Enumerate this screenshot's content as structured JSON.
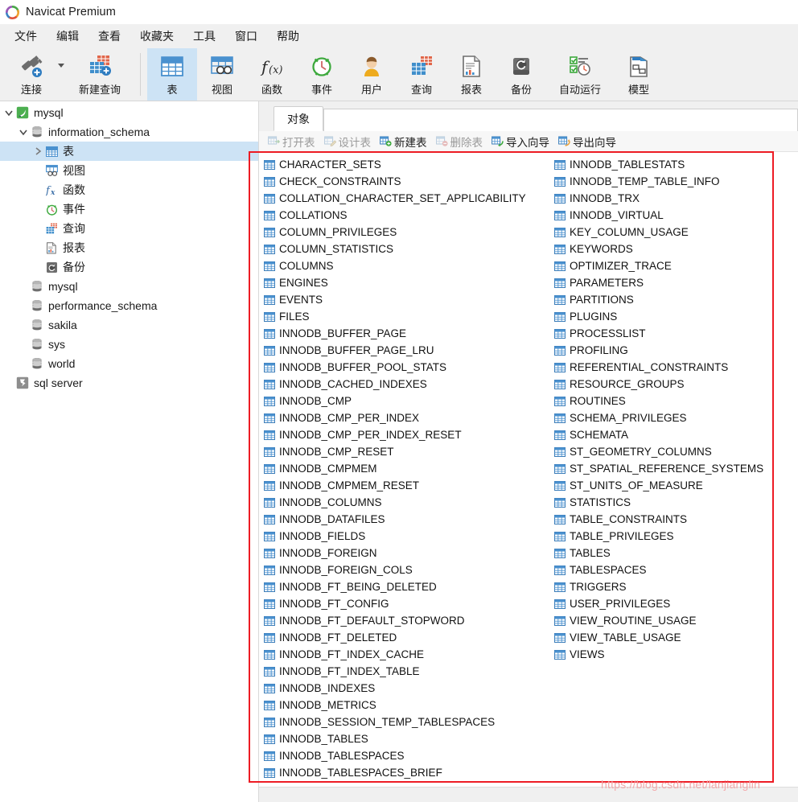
{
  "window": {
    "title": "Navicat Premium",
    "logo_icon": "navicat-logo-icon"
  },
  "menubar": {
    "items": [
      {
        "label": "文件",
        "name": "menu-file"
      },
      {
        "label": "编辑",
        "name": "menu-edit"
      },
      {
        "label": "查看",
        "name": "menu-view"
      },
      {
        "label": "收藏夹",
        "name": "menu-favorites"
      },
      {
        "label": "工具",
        "name": "menu-tools"
      },
      {
        "label": "窗口",
        "name": "menu-window"
      },
      {
        "label": "帮助",
        "name": "menu-help"
      }
    ]
  },
  "ribbon": {
    "buttons": [
      {
        "label": "连接",
        "icon": "connection-icon",
        "selected": false
      },
      {
        "label": "新建查询",
        "icon": "new-query-icon",
        "selected": false
      },
      {
        "label": "表",
        "icon": "table-icon",
        "selected": true
      },
      {
        "label": "视图",
        "icon": "view-icon",
        "selected": false
      },
      {
        "label": "函数",
        "icon": "function-icon",
        "selected": false
      },
      {
        "label": "事件",
        "icon": "event-icon",
        "selected": false
      },
      {
        "label": "用户",
        "icon": "user-icon",
        "selected": false
      },
      {
        "label": "查询",
        "icon": "query-icon",
        "selected": false
      },
      {
        "label": "报表",
        "icon": "report-icon",
        "selected": false
      },
      {
        "label": "备份",
        "icon": "backup-icon",
        "selected": false
      },
      {
        "label": "自动运行",
        "icon": "automation-icon",
        "selected": false
      },
      {
        "label": "模型",
        "icon": "model-icon",
        "selected": false
      }
    ],
    "dropdown_icon": "chevron-down-icon"
  },
  "sidebar": {
    "nodes": [
      {
        "label": "mysql",
        "depth": 0,
        "icon": "mysql-connection-icon",
        "twisty": "expanded",
        "selected": false
      },
      {
        "label": "information_schema",
        "depth": 1,
        "icon": "database-icon",
        "twisty": "expanded",
        "selected": false
      },
      {
        "label": "表",
        "depth": 2,
        "icon": "table-icon",
        "twisty": "collapsed",
        "selected": true
      },
      {
        "label": "视图",
        "depth": 2,
        "icon": "view-icon",
        "twisty": "none",
        "selected": false
      },
      {
        "label": "函数",
        "depth": 2,
        "icon": "function-icon",
        "twisty": "none",
        "selected": false
      },
      {
        "label": "事件",
        "depth": 2,
        "icon": "event-icon",
        "twisty": "none",
        "selected": false
      },
      {
        "label": "查询",
        "depth": 2,
        "icon": "query-icon",
        "twisty": "none",
        "selected": false
      },
      {
        "label": "报表",
        "depth": 2,
        "icon": "report-icon",
        "twisty": "none",
        "selected": false
      },
      {
        "label": "备份",
        "depth": 2,
        "icon": "backup-icon",
        "twisty": "none",
        "selected": false
      },
      {
        "label": "mysql",
        "depth": 1,
        "icon": "database-icon",
        "twisty": "none",
        "selected": false
      },
      {
        "label": "performance_schema",
        "depth": 1,
        "icon": "database-icon",
        "twisty": "none",
        "selected": false
      },
      {
        "label": "sakila",
        "depth": 1,
        "icon": "database-icon",
        "twisty": "none",
        "selected": false
      },
      {
        "label": "sys",
        "depth": 1,
        "icon": "database-icon",
        "twisty": "none",
        "selected": false
      },
      {
        "label": "world",
        "depth": 1,
        "icon": "database-icon",
        "twisty": "none",
        "selected": false
      },
      {
        "label": "sql server",
        "depth": 0,
        "icon": "sqlserver-connection-icon",
        "twisty": "none",
        "selected": false
      }
    ]
  },
  "rightpane": {
    "tabs": [
      {
        "label": "对象",
        "active": true
      }
    ],
    "object_toolbar": [
      {
        "label": "打开表",
        "icon": "open-table-icon",
        "disabled": true
      },
      {
        "label": "设计表",
        "icon": "design-table-icon",
        "disabled": true
      },
      {
        "label": "新建表",
        "icon": "new-table-icon",
        "disabled": false
      },
      {
        "label": "删除表",
        "icon": "delete-table-icon",
        "disabled": true
      },
      {
        "label": "导入向导",
        "icon": "import-wizard-icon",
        "disabled": false
      },
      {
        "label": "导出向导",
        "icon": "export-wizard-icon",
        "disabled": false
      }
    ],
    "table_list_column_1": [
      "CHARACTER_SETS",
      "CHECK_CONSTRAINTS",
      "COLLATION_CHARACTER_SET_APPLICABILITY",
      "COLLATIONS",
      "COLUMN_PRIVILEGES",
      "COLUMN_STATISTICS",
      "COLUMNS",
      "ENGINES",
      "EVENTS",
      "FILES",
      "INNODB_BUFFER_PAGE",
      "INNODB_BUFFER_PAGE_LRU",
      "INNODB_BUFFER_POOL_STATS",
      "INNODB_CACHED_INDEXES",
      "INNODB_CMP",
      "INNODB_CMP_PER_INDEX",
      "INNODB_CMP_PER_INDEX_RESET",
      "INNODB_CMP_RESET",
      "INNODB_CMPMEM",
      "INNODB_CMPMEM_RESET",
      "INNODB_COLUMNS",
      "INNODB_DATAFILES",
      "INNODB_FIELDS",
      "INNODB_FOREIGN",
      "INNODB_FOREIGN_COLS",
      "INNODB_FT_BEING_DELETED",
      "INNODB_FT_CONFIG",
      "INNODB_FT_DEFAULT_STOPWORD",
      "INNODB_FT_DELETED",
      "INNODB_FT_INDEX_CACHE",
      "INNODB_FT_INDEX_TABLE",
      "INNODB_INDEXES",
      "INNODB_METRICS",
      "INNODB_SESSION_TEMP_TABLESPACES",
      "INNODB_TABLES",
      "INNODB_TABLESPACES",
      "INNODB_TABLESPACES_BRIEF"
    ],
    "table_list_column_2": [
      "INNODB_TABLESTATS",
      "INNODB_TEMP_TABLE_INFO",
      "INNODB_TRX",
      "INNODB_VIRTUAL",
      "KEY_COLUMN_USAGE",
      "KEYWORDS",
      "OPTIMIZER_TRACE",
      "PARAMETERS",
      "PARTITIONS",
      "PLUGINS",
      "PROCESSLIST",
      "PROFILING",
      "REFERENTIAL_CONSTRAINTS",
      "RESOURCE_GROUPS",
      "ROUTINES",
      "SCHEMA_PRIVILEGES",
      "SCHEMATA",
      "ST_GEOMETRY_COLUMNS",
      "ST_SPATIAL_REFERENCE_SYSTEMS",
      "ST_UNITS_OF_MEASURE",
      "STATISTICS",
      "TABLE_CONSTRAINTS",
      "TABLE_PRIVILEGES",
      "TABLES",
      "TABLESPACES",
      "TRIGGERS",
      "USER_PRIVILEGES",
      "VIEW_ROUTINE_USAGE",
      "VIEW_TABLE_USAGE",
      "VIEWS"
    ]
  },
  "annotation": {
    "rect_color": "#ed1c24",
    "watermark": "https://blog.csdn.net/lanjianglin"
  },
  "colors": {
    "accent": "#cde3f5",
    "table_icon": "#3a7cb8",
    "chrome": "#f0f0f0"
  }
}
